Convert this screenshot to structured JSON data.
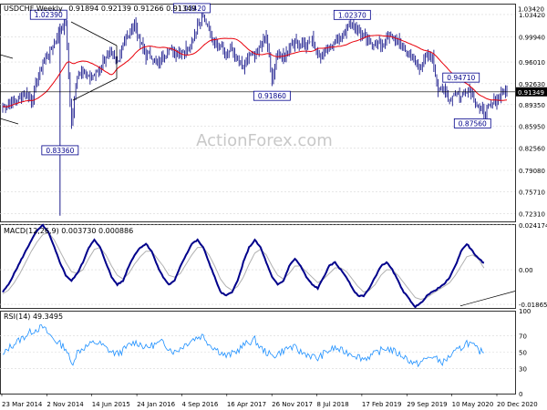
{
  "chart_data": [
    {
      "type": "ohlc",
      "title": "USDCHF,Weekly",
      "ohlc_readout": "0.91894 0.92139 0.91266 0.91349",
      "watermark": "ActionForex.com",
      "ylim": [
        0.7111,
        1.0512
      ],
      "y_ticks": [
        1.0342,
        0.9994,
        0.9601,
        0.9263,
        0.8935,
        0.8595,
        0.8256,
        0.7908,
        0.7571,
        0.7231
      ],
      "y_tick_labels": [
        "1.03420",
        "0.99940",
        "0.96010",
        "0.92630",
        "0.89350",
        "0.85950",
        "0.82560",
        "0.79080",
        "0.75710",
        "0.72310"
      ],
      "x_tick_labels": [
        "23 Mar 2014",
        "2 Nov 2014",
        "14 Jun 2015",
        "24 Jan 2016",
        "4 Sep 2016",
        "16 Apr 2017",
        "26 Nov 2017",
        "8 Jul 2018",
        "17 Feb 2019",
        "29 Sep 2019",
        "10 May 2020",
        "20 Dec 2020"
      ],
      "last_price": 0.91349,
      "last_price_label": "0.91349",
      "top_price_label": "1.03420",
      "horizontal_level": 0.9135,
      "moving_average_color": "#e8000b",
      "price_color": "#1a1a8c",
      "annotations": [
        {
          "label": "1.02390",
          "value": 1.0239,
          "date": "2014-11"
        },
        {
          "label": "0.83360",
          "value": 0.8336,
          "date": "2015-01"
        },
        {
          "label": "1.03420",
          "value": 1.0342,
          "date": "2016-12"
        },
        {
          "label": "0.91860",
          "value": 0.9186,
          "date": "2018-02"
        },
        {
          "label": "1.02370",
          "value": 1.0237,
          "date": "2019-04"
        },
        {
          "label": "0.94710",
          "value": 0.9471,
          "date": "2020-11"
        },
        {
          "label": "0.87560",
          "value": 0.8756,
          "date": "2021-01"
        }
      ],
      "series": [
        {
          "values_monthly": [
            0.89,
            0.895,
            0.9,
            0.905,
            0.91,
            0.9,
            0.93,
            0.96,
            0.97,
            0.99,
            1.01,
            1.02,
            0.86,
            0.94,
            0.95,
            0.935,
            0.94,
            0.95,
            0.97,
            0.97,
            0.96,
            0.99,
            1.0,
            1.02,
            0.99,
            0.97,
            0.97,
            0.955,
            0.97,
            0.98,
            0.975,
            0.975,
            0.98,
            0.99,
            1.02,
            1.03,
            1.01,
            0.99,
            0.99,
            0.97,
            0.98,
            0.96,
            0.95,
            0.97,
            0.965,
            0.985,
            1.0,
            0.93,
            0.975,
            0.965,
            0.985,
            0.99,
            0.99,
            0.985,
            0.995,
            0.97,
            0.975,
            0.985,
            0.99,
            1.0,
            1.015,
            1.02,
            1.01,
            1.0,
            0.99,
            0.99,
            0.985,
            0.995,
            1.0,
            0.99,
            0.98,
            0.97,
            0.96,
            0.95,
            0.97,
            0.965,
            0.92,
            0.915,
            0.9,
            0.915,
            0.905,
            0.92,
            0.91,
            0.89,
            0.88,
            0.89,
            0.9,
            0.91,
            0.9135
          ]
        }
      ]
    },
    {
      "type": "line",
      "title": "MACD(12,26,9) 0.003730 0.000886",
      "ylim": [
        -0.0206,
        0.0246
      ],
      "y_ticks": [
        0.024174,
        0.0,
        -0.018653
      ],
      "y_tick_labels": [
        "0.024174",
        "0.00",
        "-0.018653"
      ],
      "series": [
        {
          "name": "MACD",
          "color": "#00008b",
          "values_monthly": [
            -0.012,
            -0.008,
            -0.002,
            0.004,
            0.01,
            0.016,
            0.021,
            0.024,
            0.02,
            0.012,
            0.004,
            -0.003,
            -0.006,
            -0.002,
            0.004,
            0.012,
            0.016,
            0.012,
            0.004,
            -0.004,
            -0.008,
            -0.006,
            0.002,
            0.008,
            0.012,
            0.014,
            0.01,
            0.002,
            -0.004,
            -0.008,
            -0.006,
            0.002,
            0.008,
            0.014,
            0.016,
            0.012,
            0.004,
            -0.004,
            -0.012,
            -0.014,
            -0.012,
            -0.006,
            0.004,
            0.012,
            0.016,
            0.012,
            0.004,
            -0.004,
            -0.008,
            -0.006,
            0.002,
            0.006,
            0.002,
            -0.004,
            -0.008,
            -0.01,
            -0.004,
            0.002,
            0.004,
            0.0,
            -0.004,
            -0.01,
            -0.014,
            -0.014,
            -0.01,
            -0.004,
            0.002,
            0.004,
            0.0,
            -0.006,
            -0.012,
            -0.016,
            -0.02,
            -0.018,
            -0.014,
            -0.012,
            -0.01,
            -0.008,
            -0.004,
            0.002,
            0.01,
            0.014,
            0.01,
            0.006,
            0.0037
          ]
        },
        {
          "name": "Signal",
          "color": "#b0b0b0",
          "values_monthly": [
            -0.013,
            -0.011,
            -0.007,
            -0.002,
            0.004,
            0.01,
            0.015,
            0.019,
            0.02,
            0.016,
            0.01,
            0.004,
            -0.001,
            -0.002,
            0.0,
            0.006,
            0.011,
            0.012,
            0.008,
            0.002,
            -0.003,
            -0.005,
            -0.002,
            0.003,
            0.007,
            0.01,
            0.01,
            0.006,
            0.002,
            -0.003,
            -0.004,
            -0.002,
            0.003,
            0.008,
            0.012,
            0.012,
            0.008,
            0.002,
            -0.005,
            -0.009,
            -0.011,
            -0.009,
            -0.004,
            0.003,
            0.009,
            0.011,
            0.008,
            0.002,
            -0.003,
            -0.005,
            -0.002,
            0.002,
            0.002,
            -0.001,
            -0.004,
            -0.007,
            -0.005,
            -0.002,
            0.001,
            0.001,
            -0.001,
            -0.005,
            -0.009,
            -0.012,
            -0.011,
            -0.008,
            -0.003,
            0.0,
            0.0,
            -0.003,
            -0.007,
            -0.011,
            -0.015,
            -0.016,
            -0.015,
            -0.013,
            -0.011,
            -0.009,
            -0.007,
            -0.003,
            0.002,
            0.007,
            0.008,
            0.006,
            0.000886
          ]
        }
      ]
    },
    {
      "type": "line",
      "title": "RSI(14) 49.3495",
      "ylim": [
        0,
        100
      ],
      "y_ticks": [
        100,
        70,
        50,
        30,
        0
      ],
      "y_tick_labels": [
        "100",
        "70",
        "50",
        "30",
        "0"
      ],
      "series": [
        {
          "name": "RSI",
          "color": "#1e90ff",
          "values_monthly": [
            45,
            55,
            60,
            65,
            70,
            75,
            78,
            80,
            72,
            65,
            60,
            55,
            35,
            50,
            55,
            58,
            62,
            60,
            55,
            50,
            48,
            52,
            58,
            62,
            60,
            55,
            58,
            60,
            62,
            55,
            50,
            55,
            60,
            65,
            68,
            70,
            60,
            55,
            50,
            45,
            48,
            52,
            58,
            62,
            65,
            55,
            50,
            45,
            48,
            52,
            56,
            55,
            50,
            48,
            45,
            42,
            48,
            52,
            55,
            52,
            50,
            48,
            45,
            42,
            45,
            48,
            52,
            55,
            52,
            48,
            45,
            40,
            35,
            38,
            42,
            45,
            40,
            38,
            45,
            50,
            55,
            62,
            58,
            52,
            49.35
          ]
        }
      ]
    }
  ]
}
